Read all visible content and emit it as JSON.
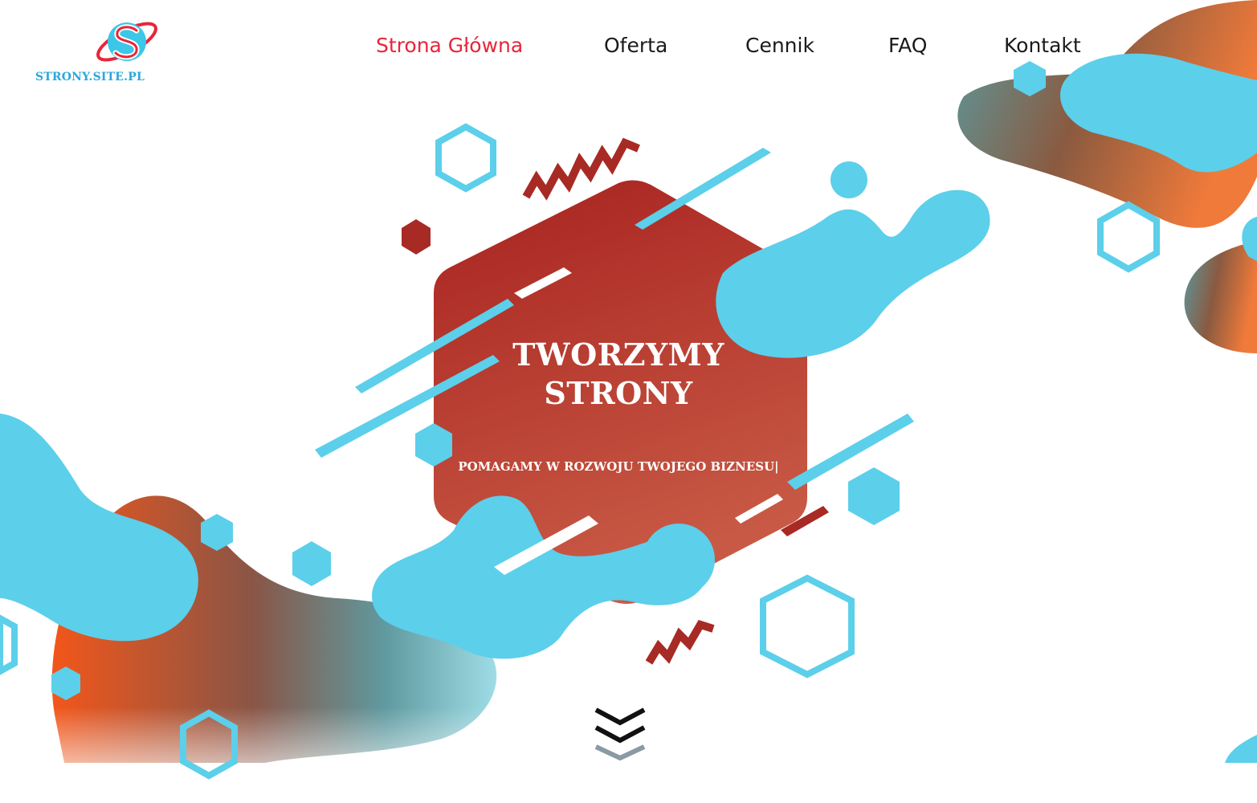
{
  "logo": {
    "text": "STRONY.SITE.PL",
    "icon": "logo-s-icon"
  },
  "nav": {
    "items": [
      {
        "label": "Strona Główna",
        "active": true
      },
      {
        "label": "Oferta",
        "active": false
      },
      {
        "label": "Cennik",
        "active": false
      },
      {
        "label": "FAQ",
        "active": false
      },
      {
        "label": "Kontakt",
        "active": false
      }
    ]
  },
  "hero": {
    "title_line1": "TWORZYMY",
    "title_line2": "STRONY",
    "subtitle": "POMAGAMY W ROZWOJU TWOJEGO BIZNESU|"
  },
  "scroll": {
    "icon": "double-chevron-down-icon"
  },
  "colors": {
    "accent": "#e8253a",
    "nav_text": "#1a1a1a",
    "light_blue": "#5ccfea",
    "dark_red": "#a82a25",
    "orange": "#f05a1e"
  }
}
